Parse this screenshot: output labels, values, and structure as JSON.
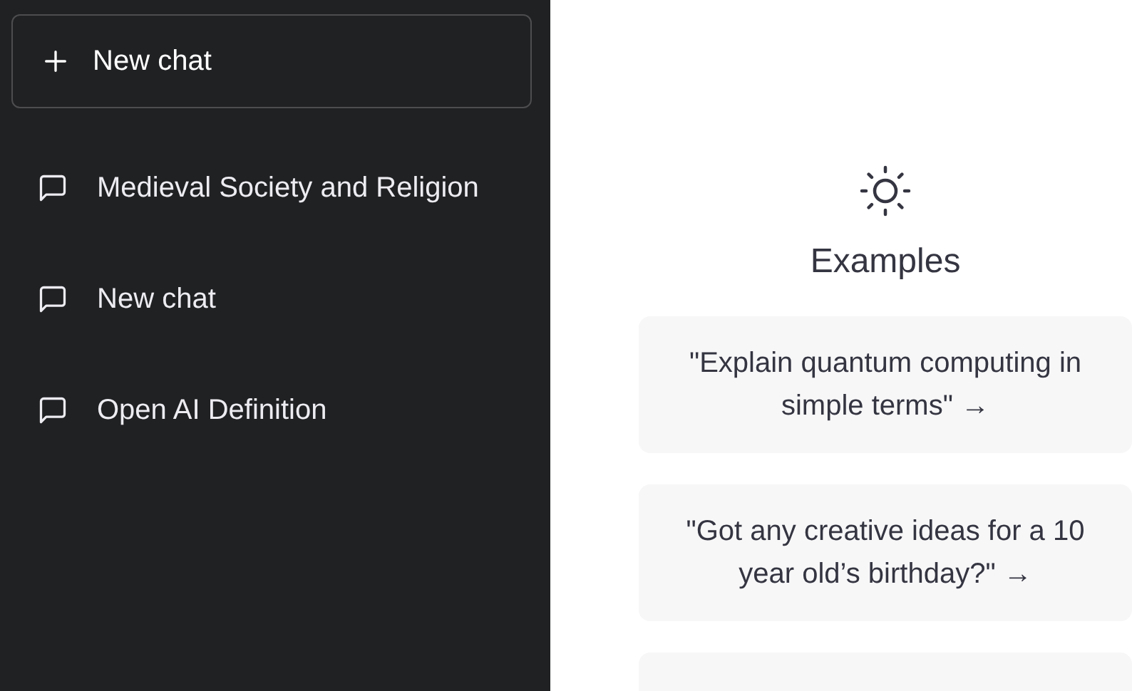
{
  "sidebar": {
    "new_chat_button": {
      "label": "New chat"
    },
    "items": [
      {
        "label": "Medieval Society and Religion"
      },
      {
        "label": "New chat"
      },
      {
        "label": "Open AI Definition"
      }
    ]
  },
  "examples": {
    "title": "Examples",
    "cards": [
      {
        "text": "\"Explain quantum computing in simple terms\" →"
      },
      {
        "text": "\"Got any creative ideas for a 10 year old’s birthday?\" →"
      }
    ],
    "more_cards_below": true
  }
}
